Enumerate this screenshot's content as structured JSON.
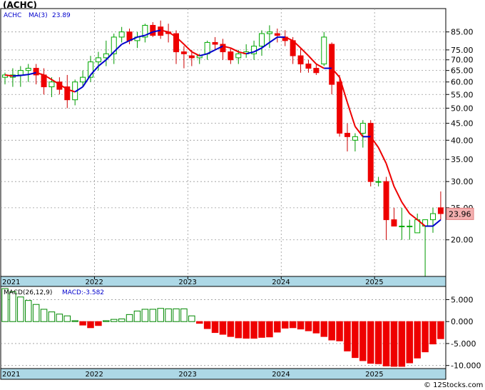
{
  "title": "(ACHC)",
  "price_panel": {
    "legend_symbol": "ACHC",
    "legend_ma_label": "MA(3)",
    "legend_ma_value": "23.89",
    "last_price_label": "23.96",
    "y_ticks": [
      "85.00",
      "75.00",
      "70.00",
      "65.00",
      "60.00",
      "55.00",
      "50.00",
      "45.00",
      "40.00",
      "35.00",
      "30.00",
      "25.00",
      "20.00"
    ],
    "x_labels": [
      "2021",
      "2022",
      "2023",
      "2024",
      "2025"
    ]
  },
  "macd_panel": {
    "legend_label": "MACD(26,12,9)",
    "legend_value_label": "MACD:-3.582",
    "y_ticks": [
      "5.000",
      "0.000",
      "-5.000",
      "-10.000"
    ],
    "x_labels": [
      "2021",
      "2022",
      "2023",
      "2024",
      "2025"
    ]
  },
  "watermark": "© 12Stocks.com",
  "colors": {
    "up": "#00aa00",
    "down": "#ee0000",
    "ma_up": "#0000cc",
    "ma_down": "#ee0000",
    "axis_band": "#add8e6",
    "grid": "#999999"
  },
  "chart_data": [
    {
      "type": "candlestick",
      "title": "(ACHC)",
      "scale": "log",
      "ylim": [
        15.5,
        100
      ],
      "x_tick_labels": [
        "2021",
        "2022",
        "2023",
        "2024",
        "2025"
      ],
      "x_tick_positions": [
        0,
        11.5,
        23.5,
        35.5,
        47.5
      ],
      "series": [
        {
          "name": "ACHC",
          "ohlc": [
            [
              62,
              64,
              59,
              63
            ],
            [
              62,
              66,
              58,
              63
            ],
            [
              63,
              67,
              58,
              65
            ],
            [
              65,
              68,
              60,
              66
            ],
            [
              66,
              68,
              59,
              63
            ],
            [
              63,
              66,
              55,
              58
            ],
            [
              58,
              62,
              54,
              60
            ],
            [
              60,
              62,
              55,
              57
            ],
            [
              58,
              63,
              50,
              53
            ],
            [
              53,
              61,
              51,
              60
            ],
            [
              60,
              65,
              58,
              62
            ],
            [
              62,
              72,
              60,
              69
            ],
            [
              69,
              74,
              65,
              71
            ],
            [
              71,
              80,
              67,
              73
            ],
            [
              73,
              84,
              68,
              82
            ],
            [
              82,
              88,
              79,
              85
            ],
            [
              85,
              87,
              78,
              80
            ],
            [
              80,
              85,
              76,
              82
            ],
            [
              82,
              90,
              79,
              89
            ],
            [
              89,
              91,
              82,
              83
            ],
            [
              88,
              92,
              81,
              83
            ],
            [
              85,
              90,
              79,
              84
            ],
            [
              84,
              86,
              68,
              74
            ],
            [
              74,
              77,
              66,
              73
            ],
            [
              72,
              75,
              67,
              71
            ],
            [
              71,
              73,
              68,
              72
            ],
            [
              73,
              80,
              70,
              79
            ],
            [
              79,
              82,
              75,
              78
            ],
            [
              78,
              81,
              70,
              74
            ],
            [
              74,
              76,
              68,
              70
            ],
            [
              71,
              75,
              68,
              73
            ],
            [
              73,
              78,
              71,
              74
            ],
            [
              73,
              80,
              70,
              77
            ],
            [
              77,
              86,
              72,
              84
            ],
            [
              84,
              89,
              76,
              85
            ],
            [
              84,
              87,
              79,
              83
            ],
            [
              82,
              86,
              77,
              80
            ],
            [
              80,
              82,
              68,
              72
            ],
            [
              72,
              76,
              64,
              68
            ],
            [
              68,
              70,
              64,
              66
            ],
            [
              66,
              68,
              63,
              64
            ],
            [
              68,
              85,
              67,
              82
            ],
            [
              78,
              79,
              55,
              59
            ],
            [
              60,
              63,
              41,
              42
            ],
            [
              42,
              45,
              37,
              41
            ],
            [
              40,
              42,
              37,
              41
            ],
            [
              42,
              46,
              38,
              45
            ],
            [
              45,
              46,
              29,
              30
            ],
            [
              30,
              31,
              29,
              30
            ],
            [
              30,
              31,
              20,
              23
            ],
            [
              23,
              25,
              22,
              22
            ],
            [
              22,
              25,
              20,
              22
            ],
            [
              22,
              23,
              20,
              22
            ],
            [
              21,
              24,
              21,
              23
            ],
            [
              22,
              23,
              15.5,
              23
            ],
            [
              23,
              25,
              21,
              24
            ],
            [
              25,
              28,
              23,
              24
            ]
          ]
        },
        {
          "name": "MA(3)",
          "values": [
            63,
            62.5,
            62.8,
            63.2,
            64,
            63,
            61,
            59,
            57,
            56,
            58,
            63,
            67,
            70,
            74,
            78,
            80,
            82,
            83,
            85,
            86,
            85,
            82,
            78,
            74,
            72,
            73,
            75,
            77,
            76,
            74,
            73,
            74,
            76,
            79,
            82,
            82,
            80,
            76,
            72,
            68,
            66,
            66,
            62,
            52,
            44,
            41,
            41,
            38,
            34,
            29,
            26,
            24,
            23,
            22,
            22,
            23,
            23.9
          ]
        }
      ]
    },
    {
      "type": "bar",
      "title": "MACD(26,12,9)",
      "ylim": [
        -10.7,
        8
      ],
      "x_tick_labels": [
        "2021",
        "2022",
        "2023",
        "2024",
        "2025"
      ],
      "series": [
        {
          "name": "MACD",
          "values": [
            7.5,
            6.8,
            5.6,
            4.8,
            3.9,
            2.8,
            2.2,
            1.7,
            1.3,
            0.2,
            -0.8,
            -1.4,
            -0.9,
            0.2,
            0.5,
            0.6,
            1.6,
            2.4,
            2.8,
            2.8,
            3,
            2.9,
            2.9,
            2.9,
            1.3,
            -0.4,
            -1.6,
            -2.5,
            -2.9,
            -3.4,
            -3.7,
            -3.8,
            -3.8,
            -3.6,
            -3.5,
            -2.4,
            -1.5,
            -1.4,
            -1.7,
            -2.1,
            -2.6,
            -3.4,
            -4.2,
            -4.4,
            -6.7,
            -8.2,
            -8.9,
            -9.5,
            -9.6,
            -10.1,
            -10.2,
            -10.2,
            -9.4,
            -8.3,
            -6.9,
            -5.1,
            -3.9
          ]
        }
      ]
    }
  ]
}
